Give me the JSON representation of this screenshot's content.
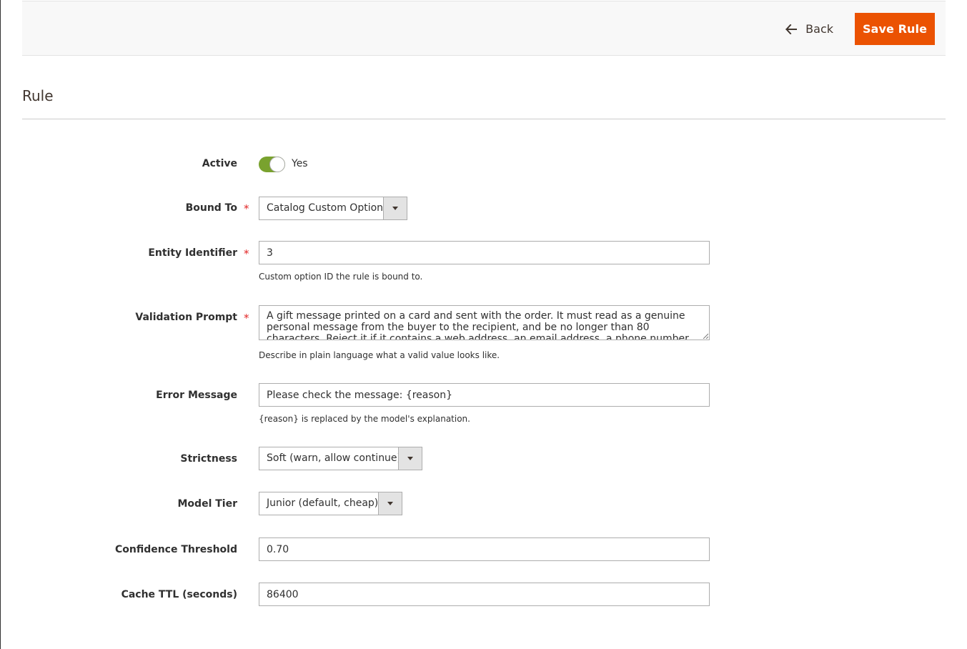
{
  "header": {
    "back_label": "Back",
    "save_label": "Save Rule"
  },
  "section": {
    "title": "Rule"
  },
  "fields": {
    "active": {
      "label": "Active",
      "toggle_text": "Yes",
      "enabled": true
    },
    "bound_to": {
      "label": "Bound To",
      "required_mark": "*",
      "value": "Catalog Custom Option"
    },
    "entity_identifier": {
      "label": "Entity Identifier",
      "required_mark": "*",
      "value": "3",
      "note": "Custom option ID the rule is bound to."
    },
    "validation_prompt": {
      "label": "Validation Prompt",
      "required_mark": "*",
      "value": "A gift message printed on a card and sent with the order. It must read as a genuine personal message from the buyer to the recipient, and be no longer than 80 characters. Reject it if it contains a web address, an email address, a phone number, promotional or advertising text",
      "note": "Describe in plain language what a valid value looks like."
    },
    "error_message": {
      "label": "Error Message",
      "value": "Please check the message: {reason}",
      "note": "{reason} is replaced by the model's explanation."
    },
    "strictness": {
      "label": "Strictness",
      "value": "Soft (warn, allow continue)"
    },
    "model_tier": {
      "label": "Model Tier",
      "value": "Junior (default, cheap)"
    },
    "confidence_threshold": {
      "label": "Confidence Threshold",
      "value": "0.70"
    },
    "cache_ttl": {
      "label": "Cache TTL (seconds)",
      "value": "86400"
    }
  },
  "colors": {
    "primary_button": "#eb5202",
    "toggle_on": "#79a22e",
    "required": "#e22626"
  }
}
